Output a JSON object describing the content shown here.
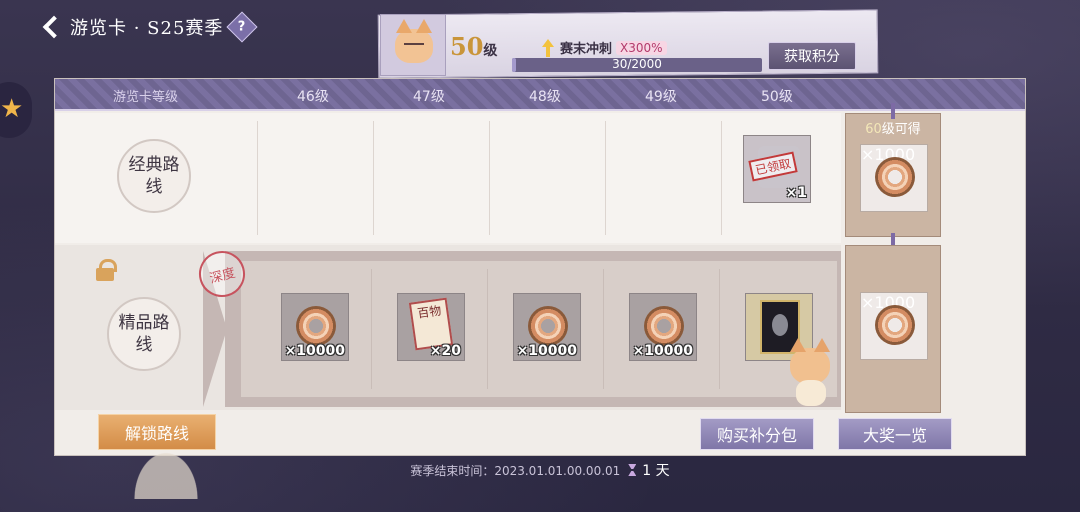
{
  "topbar": {
    "title": "游览卡 · S25赛季",
    "help": "?"
  },
  "level_card": {
    "level_number": "50",
    "level_unit": "级",
    "boost_label": "赛末冲刺",
    "boost_multiplier": "X300%",
    "xp_text": "30/2000",
    "xp_fraction": 0.015,
    "get_points_label": "获取积分"
  },
  "header": {
    "row_label": "游览卡等级",
    "levels": [
      "46级",
      "47级",
      "48级",
      "49级",
      "50级"
    ]
  },
  "routes": {
    "classic": "经典路线",
    "premium": "精品路线",
    "premium_stamp": "深度"
  },
  "classic_items": {
    "lvl50": {
      "count": "×1",
      "claimed": "已领取"
    }
  },
  "premium_items": [
    {
      "icon": "coin-icon",
      "count": "×10000"
    },
    {
      "icon": "scroll-icon",
      "label": "百物",
      "count": "×20"
    },
    {
      "icon": "coin-icon",
      "count": "×10000"
    },
    {
      "icon": "coin-icon",
      "count": "×10000"
    },
    {
      "icon": "card-icon",
      "count": ""
    }
  ],
  "level60": {
    "label_num": "60",
    "label_text": "级可得",
    "classic_count": "×1000",
    "premium_count": "×1000"
  },
  "buttons": {
    "unlock": "解锁路线",
    "buy_pack": "购买补分包",
    "prize_list": "大奖一览"
  },
  "footer": {
    "end_label": "赛季结束时间：2023.01.01.00.00.01",
    "remaining": "1 天"
  }
}
